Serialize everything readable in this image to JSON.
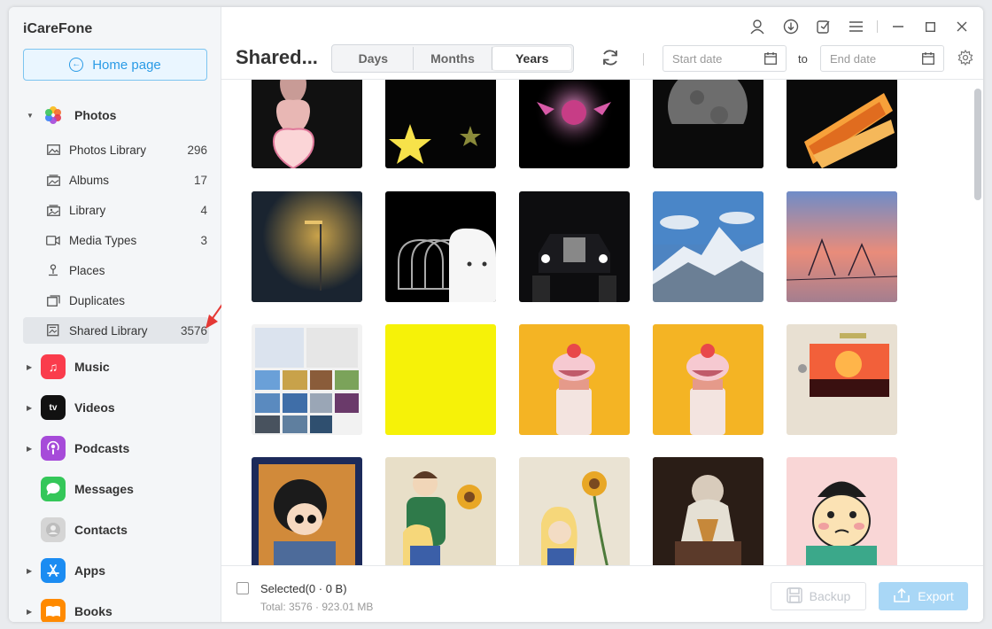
{
  "app": {
    "title": "iCareFone"
  },
  "sidebar": {
    "home_label": "Home page",
    "photos": {
      "label": "Photos",
      "items": [
        {
          "label": "Photos Library",
          "count": "296",
          "icon": "photo-icon"
        },
        {
          "label": "Albums",
          "count": "17",
          "icon": "album-icon"
        },
        {
          "label": "Library",
          "count": "4",
          "icon": "library-icon"
        },
        {
          "label": "Media Types",
          "count": "3",
          "icon": "video-camera-icon"
        },
        {
          "label": "Places",
          "count": "",
          "icon": "pin-icon"
        },
        {
          "label": "Duplicates",
          "count": "",
          "icon": "duplicate-icon"
        },
        {
          "label": "Shared Library",
          "count": "3576",
          "icon": "shared-library-icon"
        }
      ]
    },
    "categories": [
      {
        "label": "Music",
        "icon": "music-icon",
        "color": "#fa3c4c",
        "expandable": true
      },
      {
        "label": "Videos",
        "icon": "tv-icon",
        "color": "#111111",
        "expandable": true
      },
      {
        "label": "Podcasts",
        "icon": "podcast-icon",
        "color": "#a64bd9",
        "expandable": true
      },
      {
        "label": "Messages",
        "icon": "messages-icon",
        "color": "#34c759",
        "expandable": false
      },
      {
        "label": "Contacts",
        "icon": "contacts-icon",
        "color": "#c8c8c8",
        "expandable": false
      },
      {
        "label": "Apps",
        "icon": "appstore-icon",
        "color": "#1b8cf2",
        "expandable": true
      },
      {
        "label": "Books",
        "icon": "books-icon",
        "color": "#ff8a00",
        "expandable": true
      }
    ]
  },
  "header": {
    "title": "Shared...",
    "tabs": [
      {
        "label": "Days",
        "selected": false
      },
      {
        "label": "Months",
        "selected": false
      },
      {
        "label": "Years",
        "selected": true
      }
    ],
    "start_placeholder": "Start date",
    "to_label": "to",
    "end_placeholder": "End date"
  },
  "footer": {
    "selected": "Selected(0 · 0 B)",
    "total": "Total: 3576 · 923.01 MB",
    "backup_label": "Backup",
    "export_label": "Export"
  },
  "colors": {
    "accent": "#2a9be6",
    "export_bg": "#a9d7f6"
  }
}
